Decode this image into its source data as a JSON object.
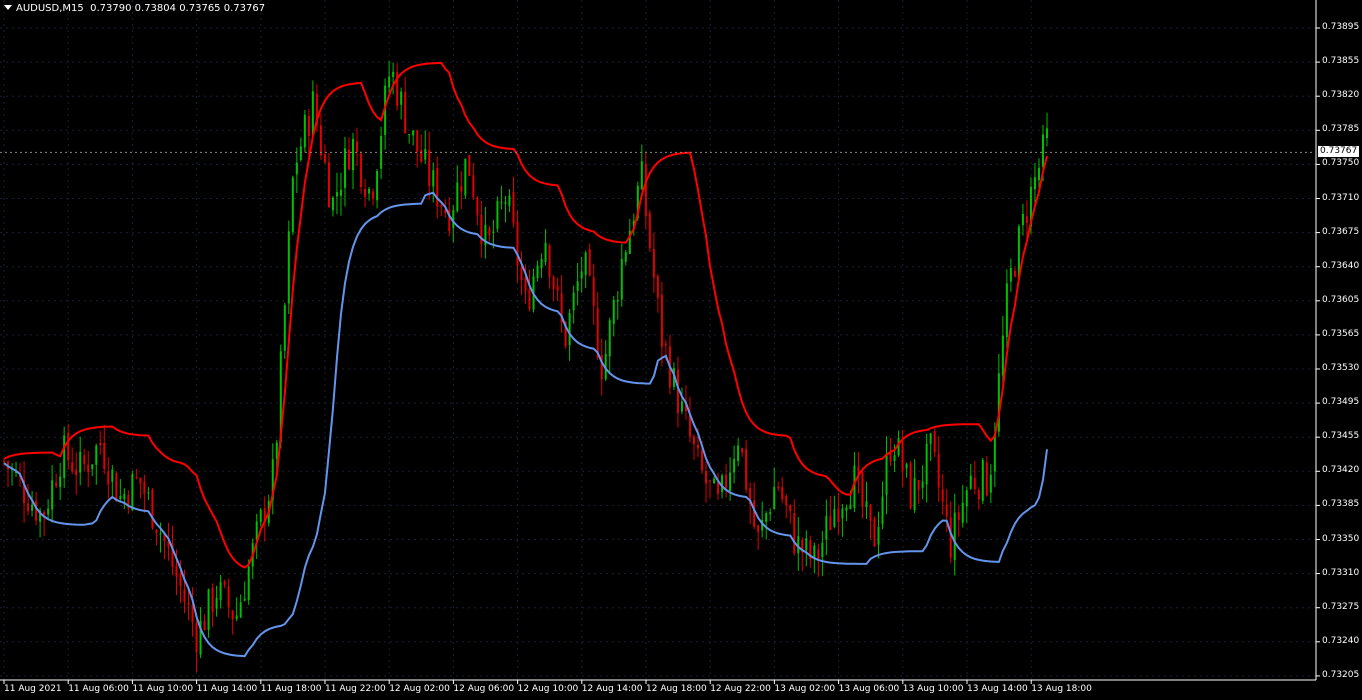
{
  "header": {
    "symbol": "AUDUSD,M15",
    "ohlc": "0.73790 0.73804 0.73765 0.73767"
  },
  "colors": {
    "background": "#000000",
    "bull_candle": "#00c000",
    "bear_candle": "#e00000",
    "resistance_line": "#ff0000",
    "support_line": "#6495ed",
    "grid": "#1a2030",
    "axis": "#ffffff"
  },
  "current_price": "0.73767",
  "chart_data": {
    "type": "candlestick",
    "y_ticks": [
      "0.73895",
      "0.73855",
      "0.73820",
      "0.73785",
      "0.73750",
      "0.73710",
      "0.73675",
      "0.73640",
      "0.73605",
      "0.73565",
      "0.73530",
      "0.73495",
      "0.73455",
      "0.73420",
      "0.73385",
      "0.73350",
      "0.73310",
      "0.73275",
      "0.73240",
      "0.73205"
    ],
    "x_ticks": [
      "11 Aug 2021",
      "11 Aug 06:00",
      "11 Aug 10:00",
      "11 Aug 14:00",
      "11 Aug 18:00",
      "11 Aug 22:00",
      "12 Aug 02:00",
      "12 Aug 06:00",
      "12 Aug 10:00",
      "12 Aug 14:00",
      "12 Aug 18:00",
      "12 Aug 22:00",
      "13 Aug 02:00",
      "13 Aug 06:00",
      "13 Aug 10:00",
      "13 Aug 14:00",
      "13 Aug 18:00"
    ],
    "ylim": [
      0.732,
      0.73918
    ],
    "close_path": [
      0.7343,
      0.734,
      0.7337,
      0.7344,
      0.7342,
      0.7345,
      0.7339,
      0.7341,
      0.7336,
      0.733,
      0.7324,
      0.7329,
      0.7326,
      0.7334,
      0.7342,
      0.7375,
      0.7382,
      0.7371,
      0.7378,
      0.7372,
      0.7386,
      0.7379,
      0.7374,
      0.737,
      0.7376,
      0.7366,
      0.7372,
      0.736,
      0.7368,
      0.7356,
      0.7365,
      0.7353,
      0.7365,
      0.7374,
      0.7357,
      0.7349,
      0.7342,
      0.7338,
      0.7346,
      0.7334,
      0.7341,
      0.7334,
      0.7332,
      0.7338,
      0.7341,
      0.7334,
      0.7346,
      0.7339,
      0.7344,
      0.7334,
      0.7341,
      0.7341,
      0.7362,
      0.7371,
      0.7378
    ]
  }
}
